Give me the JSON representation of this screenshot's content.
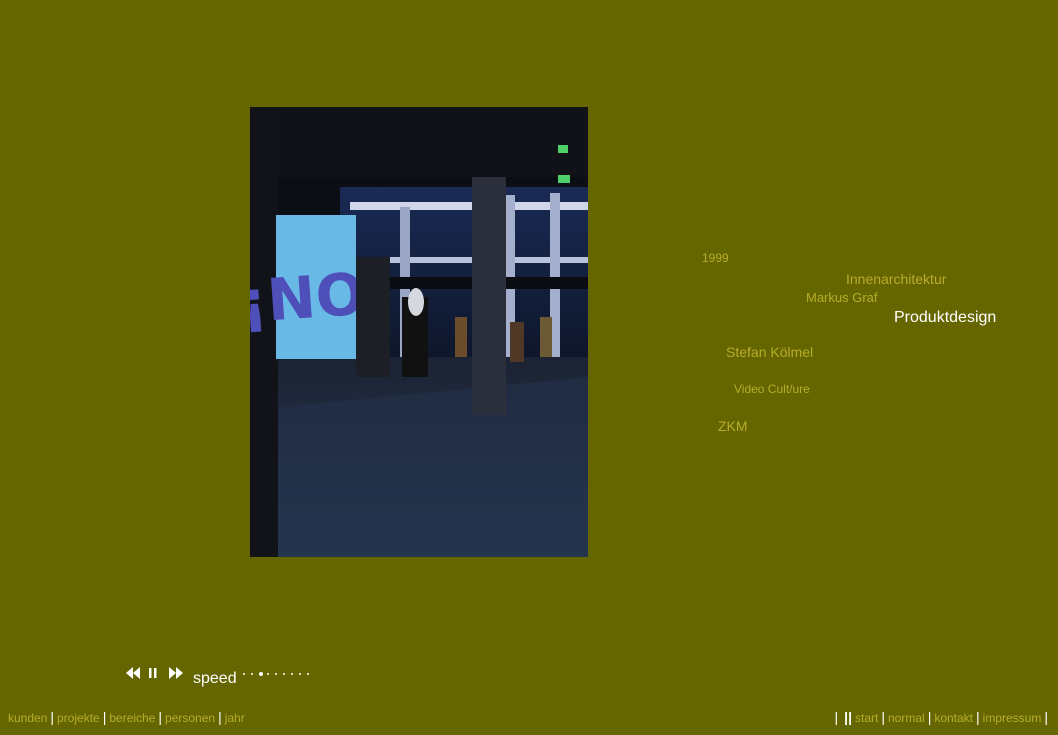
{
  "tags": [
    {
      "label": "1999",
      "active": false
    },
    {
      "label": "Innenarchitektur",
      "active": false
    },
    {
      "label": "Markus Graf",
      "active": false
    },
    {
      "label": "Produktdesign",
      "active": true
    },
    {
      "label": "Stefan Kölmel",
      "active": false
    },
    {
      "label": "Video Cult/ure",
      "active": false
    },
    {
      "label": "ZKM",
      "active": false
    }
  ],
  "player": {
    "speed_label": "speed",
    "speed_steps": 9,
    "speed_current_step": 3
  },
  "nav_left": [
    "kunden",
    "projekte",
    "bereiche",
    "personen",
    "jahr"
  ],
  "nav_right": {
    "separator": "|",
    "links": [
      "start",
      "normal",
      "kontakt",
      "impressum"
    ]
  },
  "photo": {
    "screen_text": "¡NO!"
  },
  "colors": {
    "background": "#666600",
    "tag": "#b5ad2a",
    "active": "#ffffff"
  }
}
